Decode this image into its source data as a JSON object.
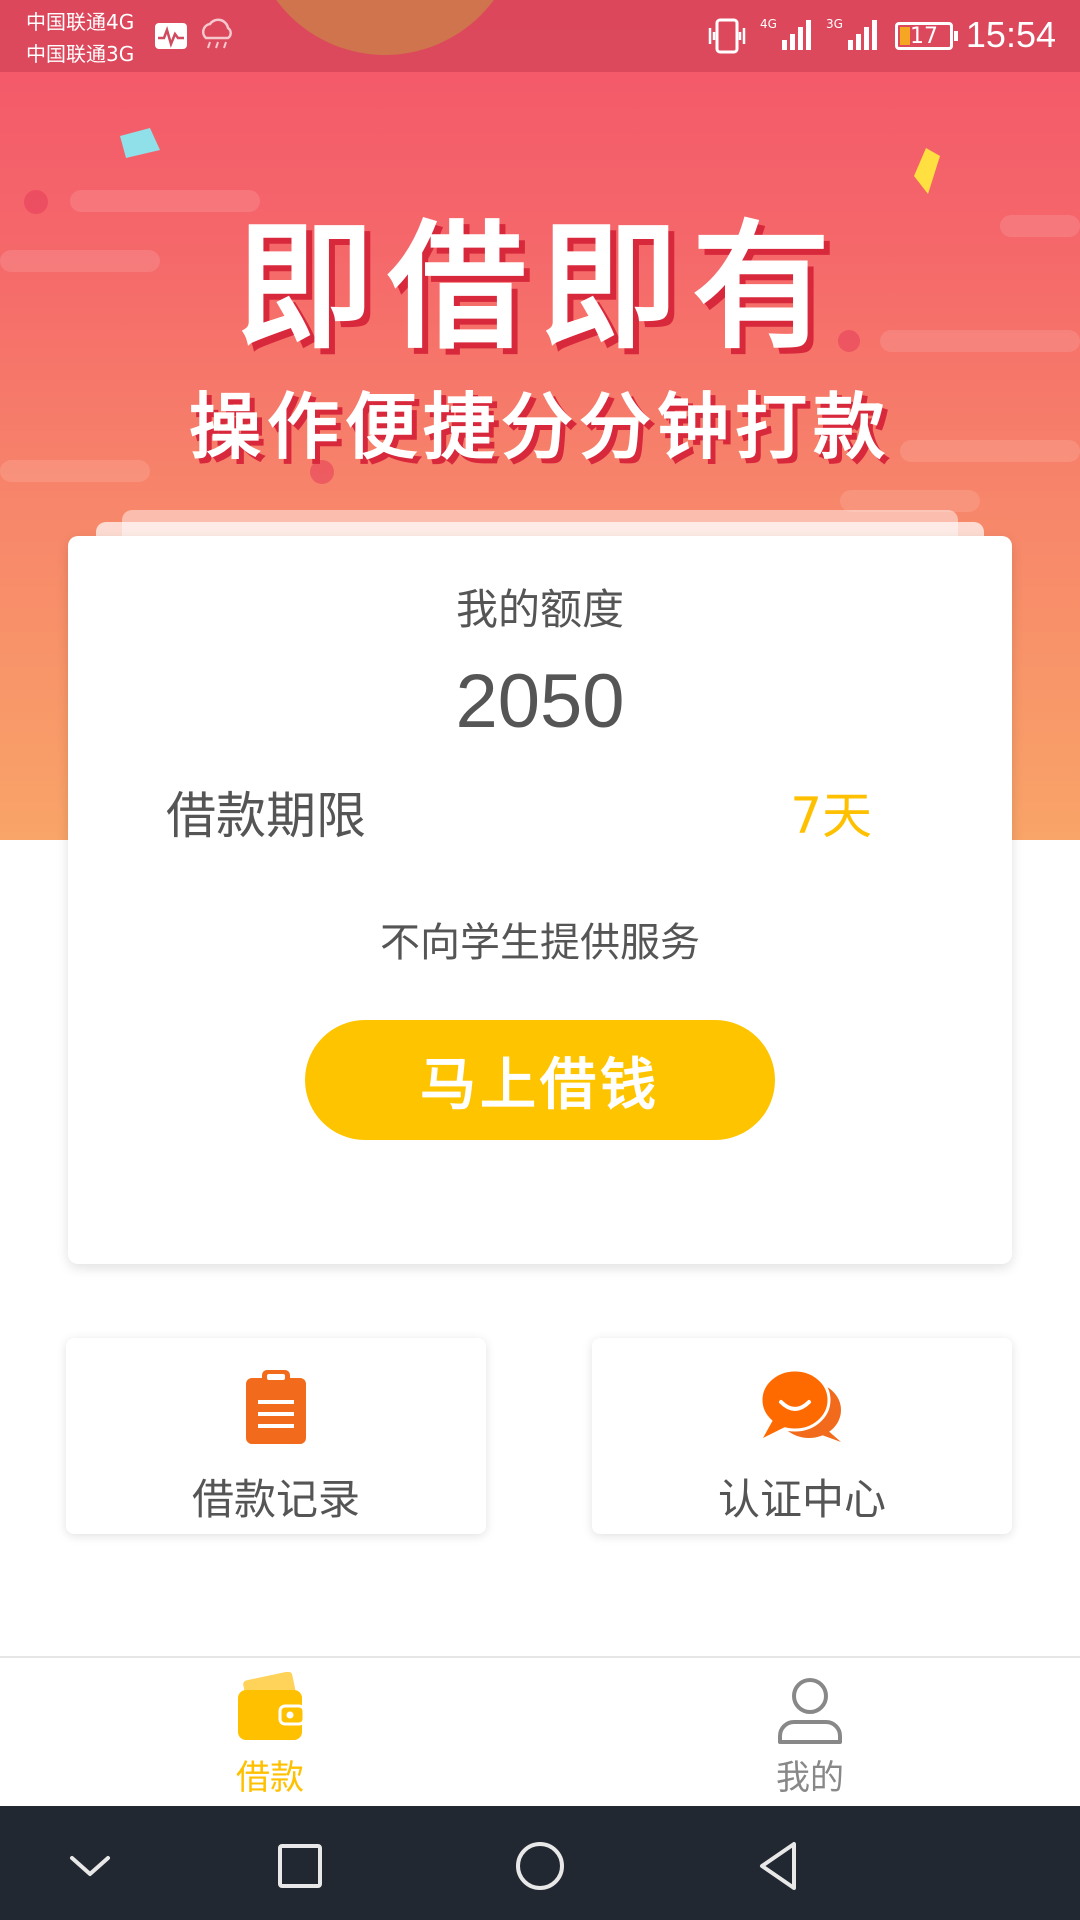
{
  "status_bar": {
    "carrier_primary": "中国联通4G",
    "carrier_secondary": "中国联通3G",
    "network_primary": "4G",
    "network_secondary": "3G",
    "battery_level": "17",
    "time": "15:54"
  },
  "banner": {
    "headline": "即借即有",
    "subline": "操作便捷分分钟打款"
  },
  "quota_card": {
    "title": "我的额度",
    "amount": "2050",
    "term_label": "借款期限",
    "term_value": "7天",
    "notice": "不向学生提供服务",
    "borrow_button": "马上借钱"
  },
  "quick_links": {
    "loan_records": "借款记录",
    "verification_center": "认证中心"
  },
  "tab_bar": {
    "tabs": [
      {
        "label": "借款",
        "icon": "wallet-icon",
        "active": true
      },
      {
        "label": "我的",
        "icon": "user-icon",
        "active": false
      }
    ]
  },
  "colors": {
    "accent": "#ffc400",
    "banner_top": "#f3546a",
    "banner_bottom": "#f9a468",
    "icon_orange": "#f26a1b",
    "nav_bar": "#222831"
  }
}
